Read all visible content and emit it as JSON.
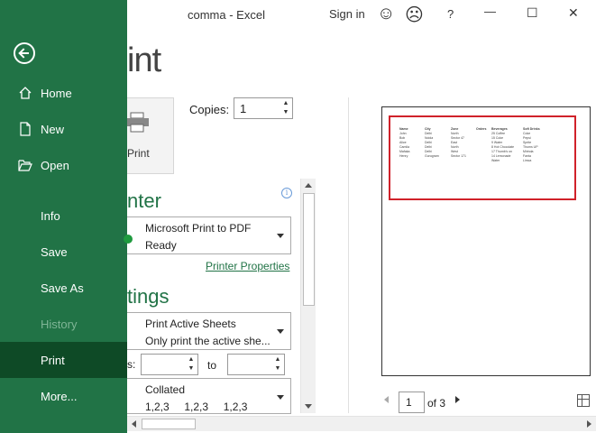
{
  "window": {
    "title": "comma  -  Excel",
    "sign_in": "Sign in",
    "smile_icon": "☺",
    "frown_icon": "☹",
    "help": "?",
    "minimize": "—",
    "maximize": "☐",
    "close": "✕"
  },
  "sidebar": {
    "items": [
      {
        "label": "Home"
      },
      {
        "label": "New"
      },
      {
        "label": "Open"
      },
      {
        "label": "Info"
      },
      {
        "label": "Save"
      },
      {
        "label": "Save As"
      },
      {
        "label": "History"
      },
      {
        "label": "Print"
      },
      {
        "label": "More..."
      }
    ]
  },
  "print": {
    "heading": "int",
    "button_label": "Print",
    "copies_label": "Copies:",
    "copies_value": "1",
    "printer_heading": "nter",
    "printer_name": "Microsoft Print to PDF",
    "printer_status": "Ready",
    "printer_properties": "Printer Properties",
    "settings_heading": "tings",
    "active_sheets_l1": "Print Active Sheets",
    "active_sheets_l2": "Only print the active she...",
    "pages_label": "s:",
    "to_label": "to",
    "collated_l1": "Collated",
    "collated_l2": "1,2,3     1,2,3     1,2,3"
  },
  "preview": {
    "page_value": "1",
    "of_label": "of 3",
    "headers": [
      "Name",
      "City",
      "Zone",
      "Orders",
      "Beverages",
      "Soft Drinks"
    ],
    "rows": [
      [
        "John",
        "Delhi",
        "North",
        "",
        "25 Coffee",
        "Coke"
      ],
      [
        "Bob",
        "Noida",
        "Sector 47",
        "",
        "15 Coke",
        "Pepsi"
      ],
      [
        "Alice",
        "Delhi",
        "East",
        "",
        "9 Water",
        "Sprite"
      ],
      [
        "Camila",
        "Delhi",
        "North",
        "",
        "8 Hot Chocolate",
        "Thums UP"
      ],
      [
        "Mafaka",
        "Delhi",
        "West",
        "",
        "17 Thumb's on",
        "Mirinda"
      ],
      [
        "Henry",
        "Gurugram",
        "Sector 171",
        "",
        "14 Lemonade",
        "Fanta"
      ],
      [
        "",
        "",
        "",
        "",
        "Water",
        "Limca"
      ]
    ]
  }
}
